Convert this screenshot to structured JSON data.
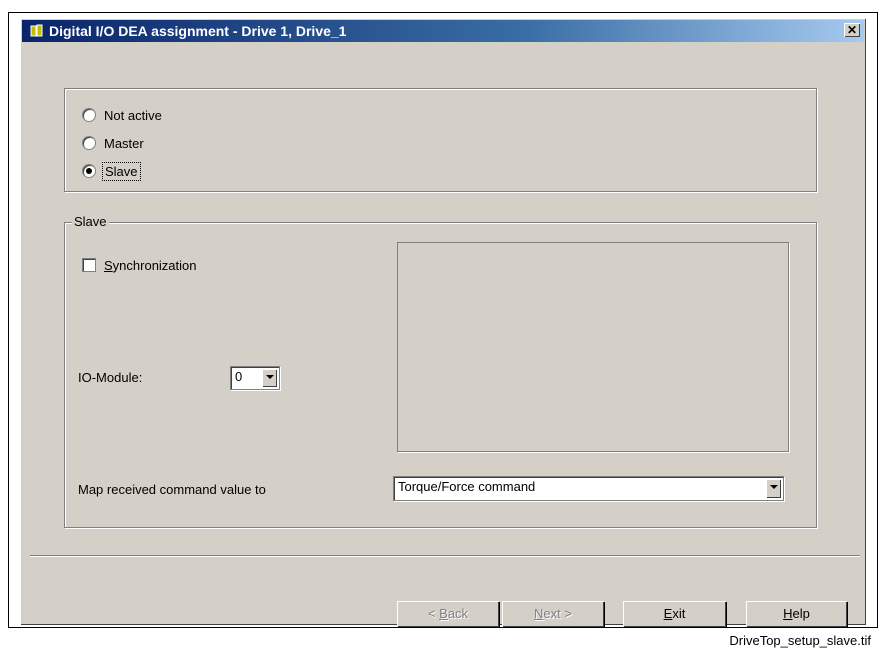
{
  "window": {
    "title": "Digital I/O DEA assignment - Drive 1,  Drive_1",
    "close_symbol": "✕"
  },
  "mode": {
    "options": [
      {
        "label": "Not active",
        "selected": false
      },
      {
        "label": "Master",
        "selected": false
      },
      {
        "label": "Slave",
        "selected": true
      }
    ]
  },
  "slave": {
    "group_label": "Slave",
    "sync": {
      "label_underlined": "S",
      "label_rest": "ynchronization",
      "checked": false
    },
    "io_module": {
      "label": "IO-Module:",
      "value": "0"
    },
    "map": {
      "label": "Map received command value to",
      "value": "Torque/Force command"
    }
  },
  "buttons": {
    "back": {
      "prefix": "< ",
      "underlined": "B",
      "rest": "ack",
      "enabled": false
    },
    "next": {
      "underlined": "N",
      "rest": "ext >",
      "enabled": false
    },
    "exit": {
      "underlined": "E",
      "rest": "xit",
      "enabled": true
    },
    "help": {
      "underlined": "H",
      "rest": "elp",
      "enabled": true
    }
  },
  "caption": "DriveTop_setup_slave.tif",
  "colors": {
    "title_start": "#0a246a",
    "title_end": "#a6caf0",
    "face": "#d4d0c8"
  }
}
